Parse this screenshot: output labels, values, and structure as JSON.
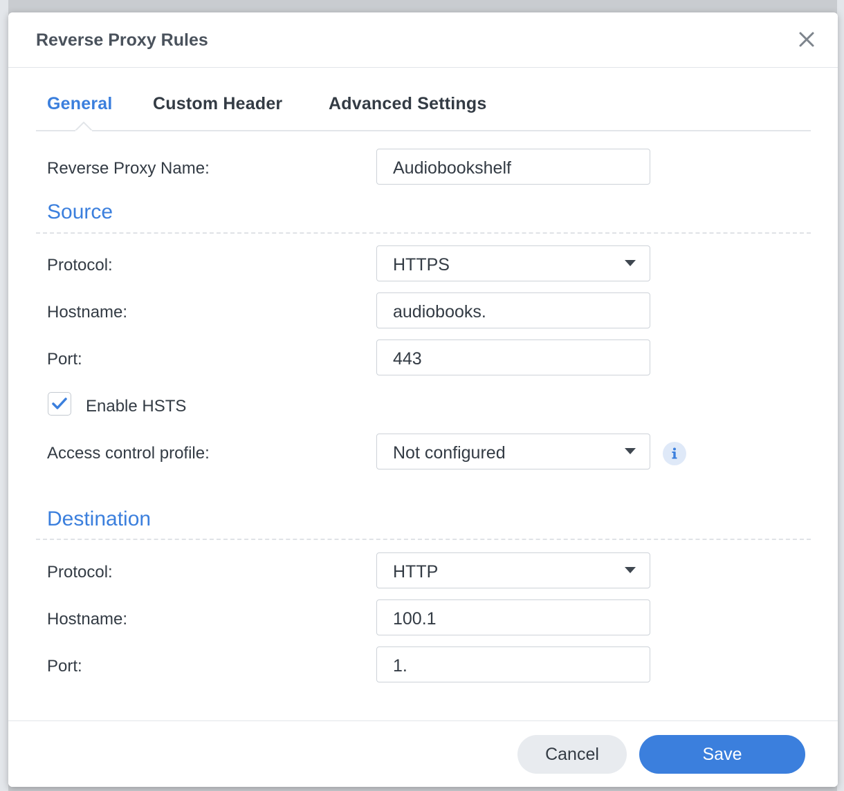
{
  "dialog": {
    "title": "Reverse Proxy Rules",
    "close_icon": "close-icon"
  },
  "tabs": [
    {
      "label": "General",
      "active": true
    },
    {
      "label": "Custom Header",
      "active": false
    },
    {
      "label": "Advanced Settings",
      "active": false
    }
  ],
  "general": {
    "name_label": "Reverse Proxy Name:",
    "name_value": "Audiobookshelf"
  },
  "source": {
    "heading": "Source",
    "protocol_label": "Protocol:",
    "protocol_value": "HTTPS",
    "hostname_label": "Hostname:",
    "hostname_value": "audiobooks.",
    "port_label": "Port:",
    "port_value": "443",
    "hsts_label": "Enable HSTS",
    "hsts_checked": true,
    "access_label": "Access control profile:",
    "access_value": "Not configured",
    "info_icon": "info-icon"
  },
  "destination": {
    "heading": "Destination",
    "protocol_label": "Protocol:",
    "protocol_value": "HTTP",
    "hostname_label": "Hostname:",
    "hostname_value": "100.1",
    "port_label": "Port:",
    "port_value": "1."
  },
  "footer": {
    "cancel_label": "Cancel",
    "save_label": "Save"
  },
  "colors": {
    "accent": "#3b7fdd",
    "text": "#333b44",
    "border": "#cdd2d8"
  }
}
